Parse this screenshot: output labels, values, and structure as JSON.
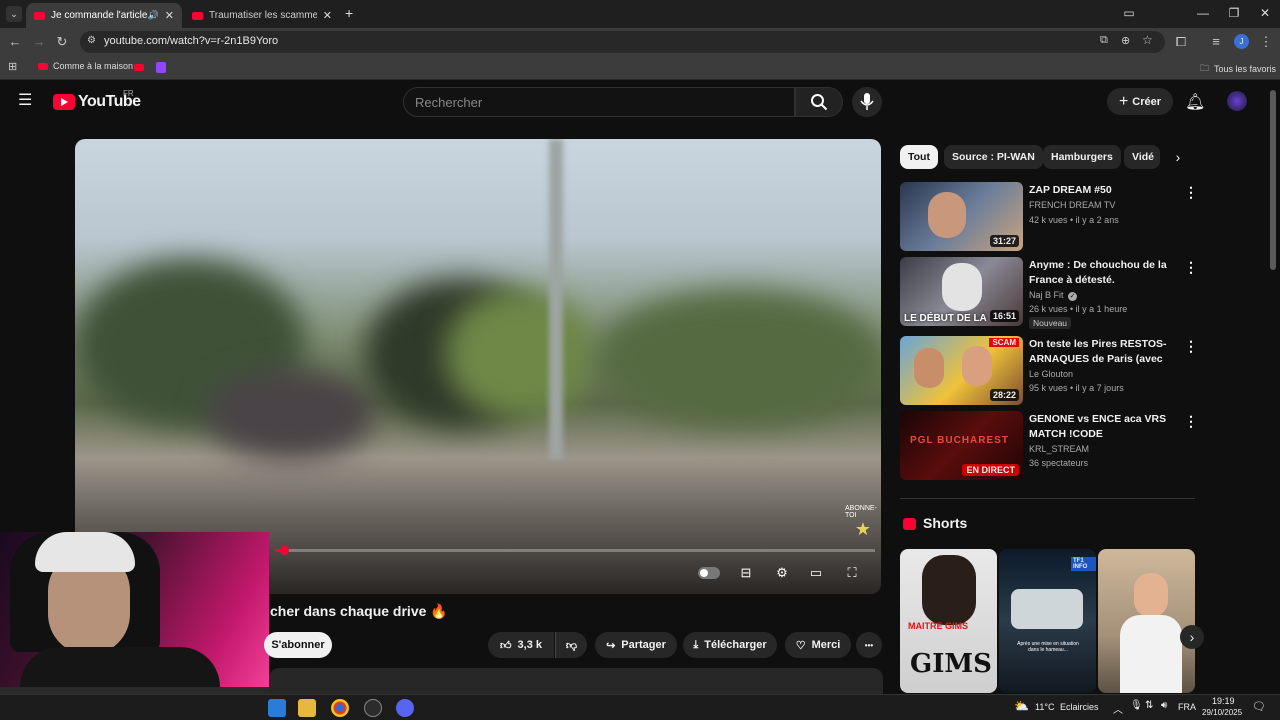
{
  "browser": {
    "tabs": [
      {
        "title": "Je commande l'article le plu",
        "active": true
      },
      {
        "title": "Traumatiser les scammers parto",
        "active": false
      }
    ],
    "new_tab": "+",
    "url": "youtube.com/watch?v=r-2n1B9Yoro",
    "bookmarks": [
      "Comme à la maison"
    ],
    "all_favorites": "Tous les favoris"
  },
  "youtube": {
    "logo": "YouTube",
    "region": "FR",
    "search_placeholder": "Rechercher",
    "create_label": "Créer",
    "player": {
      "watermark": "ABONNE-TOI",
      "progress": 0.015
    },
    "video_title": "cher dans chaque drive 🔥",
    "actions": {
      "subscribe": "S'abonner",
      "likes": "3,3 k",
      "share": "Partager",
      "download": "Télécharger",
      "thanks": "Merci",
      "more": "•••"
    },
    "chips": [
      "Tout",
      "Source : PI-WAN",
      "Hamburgers",
      "Vidé"
    ],
    "recommendations": [
      {
        "title": "ZAP DREAM #50",
        "channel": "FRENCH DREAM TV",
        "meta": "42 k vues • il y a 2 ans",
        "duration": "31:27"
      },
      {
        "title": "Anyme : De chouchou de la France à détesté.",
        "channel": "Naj B Fit",
        "meta": "26 k vues • il y a 1 heure",
        "duration": "16:51",
        "badge": "Nouveau",
        "thumb_text": "LE DÉBUT DE LA"
      },
      {
        "title": "On teste les Pires RESTOS-ARNAQUES de Paris (avec une…",
        "channel": "Le Glouton",
        "meta": "95 k vues • il y a 7 jours",
        "duration": "28:22",
        "thumb_text": "SCAM"
      },
      {
        "title": "GENONE vs ENCE aca VRS MATCH !CODE",
        "channel": "KRL_STREAM",
        "meta": "36 spectateurs",
        "live": "EN DIRECT",
        "thumb_text": "PGL BUCHAREST"
      }
    ],
    "shorts_title": "Shorts",
    "shorts": [
      {
        "text": "GIMS",
        "text2": "MAITRE GIMS"
      },
      {
        "text": "Après une mise en situation dans le hameau...",
        "badge": "TF1 INFO"
      },
      {
        "text": ""
      }
    ]
  },
  "taskbar": {
    "weather": "11°C",
    "weather_label": "Eclaircies",
    "lang": "FRA",
    "time": "19:19",
    "date": "29/10/2025"
  },
  "colors": {
    "accent": "#ff0033",
    "bg": "#0f0f0f",
    "chip": "#272727"
  }
}
